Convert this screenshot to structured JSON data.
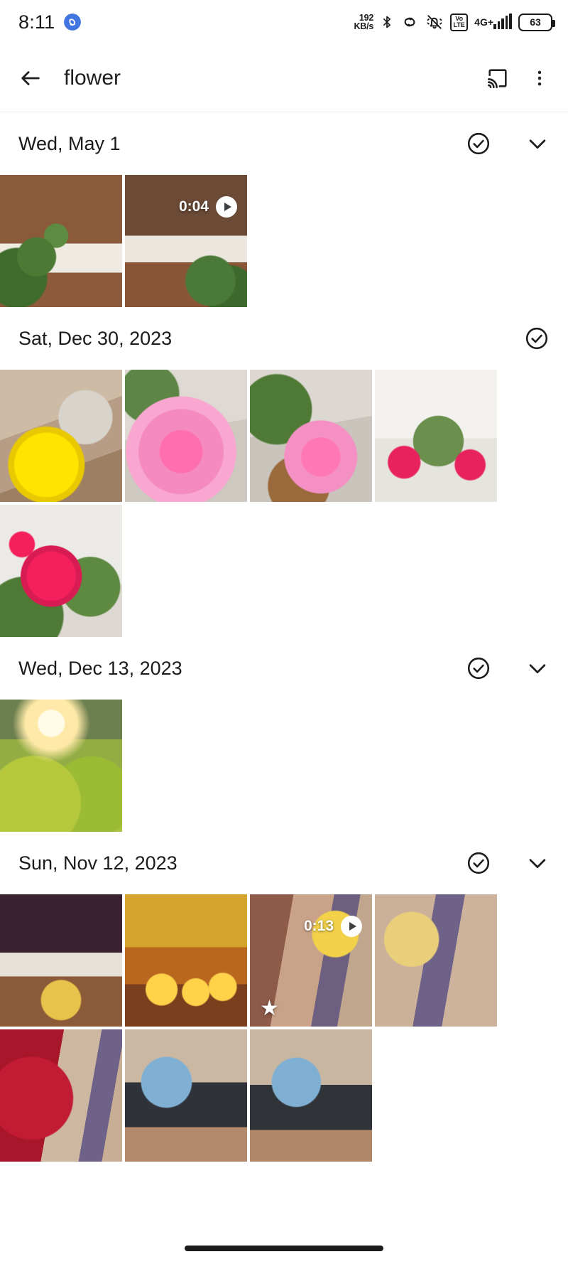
{
  "status_bar": {
    "time": "8:11",
    "left_icon": "link-badge-icon",
    "data_rate_value": "192",
    "data_rate_unit": "KB/s",
    "icons": [
      "bluetooth-icon",
      "link-icon",
      "mute-bell-icon",
      "volte-icon",
      "signal-icon",
      "battery-icon"
    ],
    "volte_top": "Vo",
    "volte_bottom": "LTE",
    "network_type": "4G+",
    "battery_level": "63"
  },
  "app_bar": {
    "back_label": "back-arrow",
    "title": "flower",
    "cast_label": "cast",
    "overflow_label": "more-options"
  },
  "sections": [
    {
      "date": "Wed, May 1",
      "has_select": true,
      "has_chevron": true,
      "columns": 2,
      "items": [
        {
          "name": "porch-plant-photo",
          "art": "ph-porch1",
          "type": "photo"
        },
        {
          "name": "porch-video",
          "art": "ph-porch2",
          "type": "video",
          "duration": "0:04"
        }
      ]
    },
    {
      "date": "Sat, Dec 30, 2023",
      "has_select": true,
      "has_chevron": false,
      "columns": 4,
      "items": [
        {
          "name": "yellow-marigold-photo",
          "art": "ph-marigold",
          "type": "photo"
        },
        {
          "name": "pink-rose-closeup-photo",
          "art": "ph-rose-pink1",
          "type": "photo"
        },
        {
          "name": "pink-rose-plant-photo",
          "art": "ph-rose-pink2",
          "type": "photo"
        },
        {
          "name": "red-rose-bush-photo",
          "art": "ph-rosebush1",
          "type": "photo"
        },
        {
          "name": "red-rose-closeup-photo",
          "art": "ph-rosebush2",
          "type": "photo"
        }
      ]
    },
    {
      "date": "Wed, Dec 13, 2023",
      "has_select": true,
      "has_chevron": true,
      "columns": 4,
      "items": [
        {
          "name": "sunlit-park-photo",
          "art": "ph-park",
          "type": "photo"
        }
      ]
    },
    {
      "date": "Sun, Nov 12, 2023",
      "has_select": true,
      "has_chevron": true,
      "columns": 4,
      "items": [
        {
          "name": "diwali-doorway-photo",
          "art": "ph-temple1",
          "type": "photo"
        },
        {
          "name": "diwali-lamps-photo",
          "art": "ph-temple2",
          "type": "photo"
        },
        {
          "name": "temple-video",
          "art": "ph-temple3",
          "type": "video",
          "duration": "0:13",
          "favorite": true
        },
        {
          "name": "temple-shrine-photo",
          "art": "ph-temple4",
          "type": "photo"
        },
        {
          "name": "woman-red-saree-photo",
          "art": "ph-saree",
          "type": "photo"
        },
        {
          "name": "man-at-shrine-photo",
          "art": "ph-man1",
          "type": "photo"
        },
        {
          "name": "man-at-shrine-photo-2",
          "art": "ph-man2",
          "type": "photo"
        }
      ]
    }
  ],
  "colors": {
    "text_primary": "#1b1b1b",
    "divider": "#e3eeee",
    "background": "#ffffff"
  },
  "star_glyph": "★"
}
